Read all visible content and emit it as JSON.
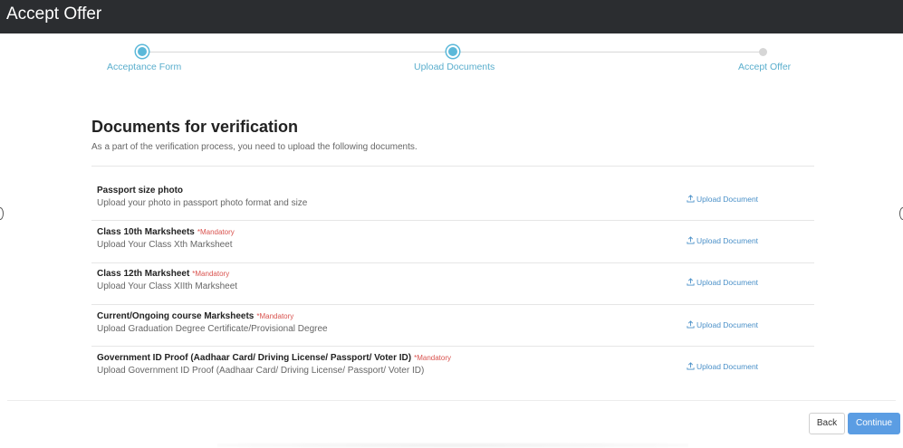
{
  "header": {
    "title": "Accept Offer"
  },
  "stepper": {
    "steps": [
      {
        "label": "Acceptance Form",
        "state": "completed"
      },
      {
        "label": "Upload Documents",
        "state": "current"
      },
      {
        "label": "Accept Offer",
        "state": "pending"
      }
    ],
    "active_color": "#5bb8d9"
  },
  "documents": {
    "title": "Documents for verification",
    "subtitle": "As a part of the verification process, you need to upload the following documents.",
    "mandatory_label": "*Mandatory",
    "upload_label": "Upload Document",
    "items": [
      {
        "name": "Passport size photo",
        "mandatory": "",
        "description": "Upload your photo in passport photo format and size",
        "upload": "Upload Document"
      },
      {
        "name": "Class 10th Marksheets",
        "mandatory": "*Mandatory",
        "description": "Upload Your Class Xth Marksheet",
        "upload": "Upload Document"
      },
      {
        "name": "Class 12th Marksheet",
        "mandatory": "*Mandatory",
        "description": "Upload Your Class XIIth Marksheet",
        "upload": "Upload Document"
      },
      {
        "name": "Current/Ongoing course Marksheets",
        "mandatory": "*Mandatory",
        "description": "Upload Graduation Degree Certificate/Provisional Degree",
        "upload": "Upload Document"
      },
      {
        "name": "Government ID Proof (Aadhaar Card/ Driving License/ Passport/ Voter ID)",
        "mandatory": "*Mandatory",
        "description": "Upload Government ID Proof (Aadhaar Card/ Driving License/ Passport/ Voter ID)",
        "upload": "Upload Document"
      }
    ]
  },
  "footer": {
    "back_label": "Back",
    "continue_label": "Continue"
  },
  "colors": {
    "header_bg": "#2b2d30",
    "primary": "#5b9de3",
    "mandatory": "#d9534f",
    "link": "#4a90c8"
  }
}
